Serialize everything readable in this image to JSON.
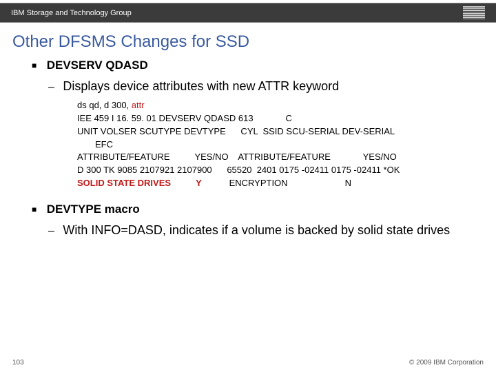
{
  "topbar": {
    "group": "IBM Storage and Technology Group"
  },
  "title": "Other DFSMS Changes for SSD",
  "b1": {
    "head": "DEVSERV QDASD",
    "sub": "Displays device attributes with new ATTR keyword",
    "code": {
      "l1a": "ds qd, d 300, ",
      "l1b": "attr",
      "l2a": "IEE 459 I 16. 59. 01 DEVSERV QDASD 613",
      "l2b": "C",
      "l3": "UNIT VOLSER SCUTYPE DEVTYPE      CYL  SSID SCU-SERIAL DEV-SERIAL",
      "l4": "EFC",
      "l5a": "ATTRIBUTE/FEATURE          YES/NO    ATTRIBUTE/FEATURE             YES/NO",
      "l6": "D 300 TK 9085 2107921 2107900      65520  2401 0175 -02411 0175 -02411 *OK",
      "l7a": "SOLID STATE DRIVES",
      "l7b": "Y",
      "l7c": "ENCRYPTION",
      "l7d": "N"
    }
  },
  "b2": {
    "head": "DEVTYPE macro",
    "sub": "With INFO=DASD, indicates if a volume is backed by solid state drives"
  },
  "footer": {
    "page": "103",
    "copyright": "© 2009 IBM Corporation"
  }
}
